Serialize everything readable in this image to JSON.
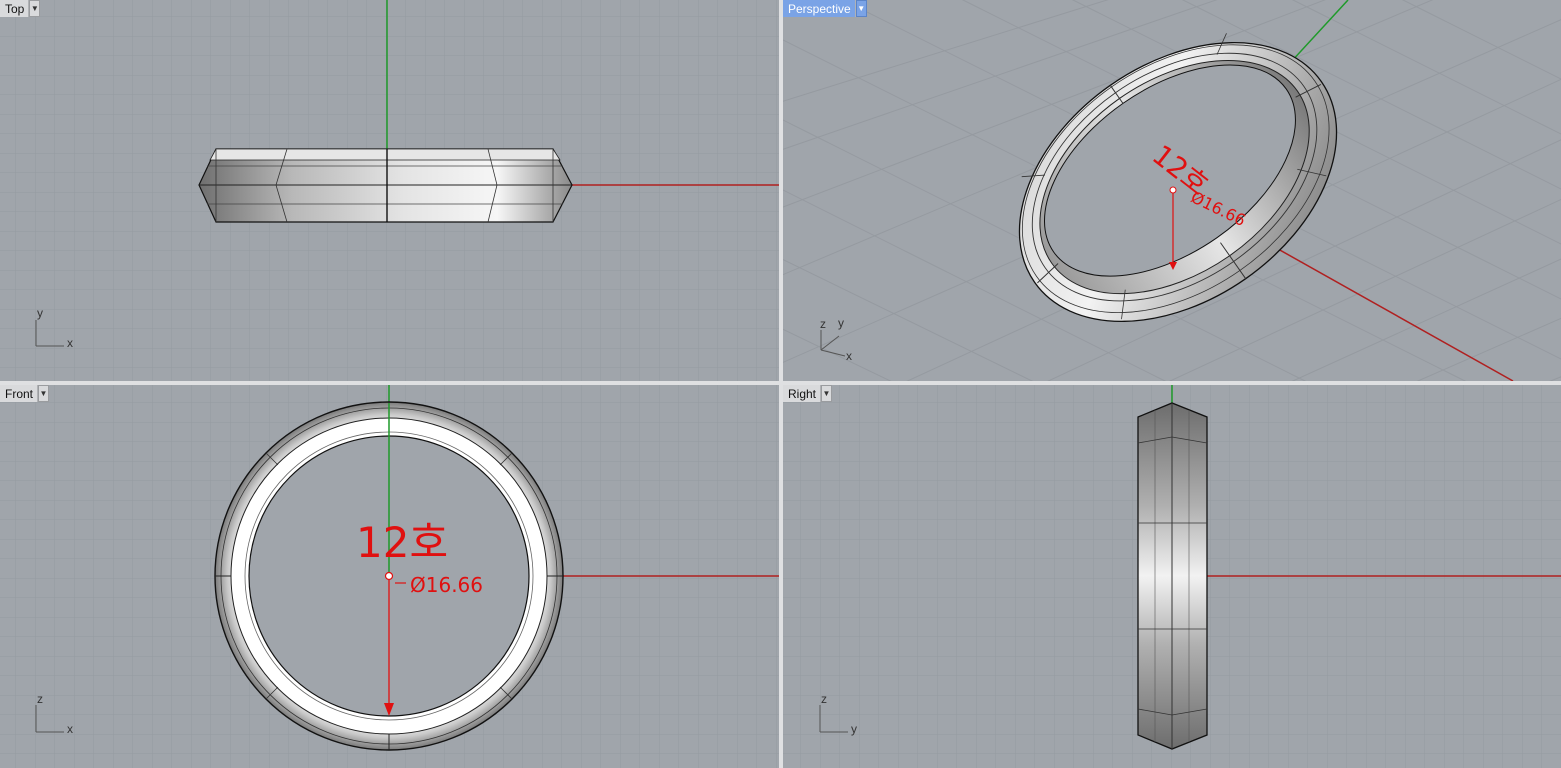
{
  "viewports": {
    "top": {
      "label": "Top",
      "axis_a": "y",
      "axis_b": "x"
    },
    "perspective": {
      "label": "Perspective",
      "axis_z": "z",
      "axis_a": "y",
      "axis_b": "x"
    },
    "front": {
      "label": "Front",
      "axis_a": "z",
      "axis_b": "x"
    },
    "right": {
      "label": "Right",
      "axis_a": "z",
      "axis_b": "y"
    }
  },
  "dropdown_icon": "chevron-down-icon",
  "annotation": {
    "size_label": "12호",
    "diameter_label": "Ø16.66"
  },
  "colors": {
    "viewport_bg": "#a0a5ab",
    "grid": "#8f949a",
    "x_axis": "#b02020",
    "y_axis": "#1f9a2a",
    "annotation": "#e01010",
    "active_tab": "#7aa3e6"
  }
}
